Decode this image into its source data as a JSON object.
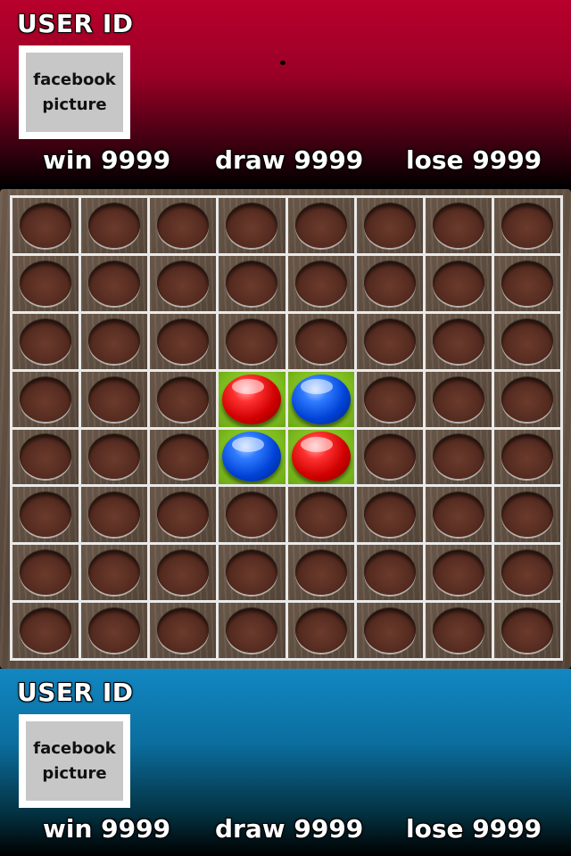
{
  "top_player": {
    "user_id": "USER ID",
    "picture_label": "facebook\npicture",
    "win": "win 9999",
    "draw": "draw 9999",
    "lose": "lose 9999"
  },
  "bottom_player": {
    "user_id": "USER ID",
    "picture_label": "facebook\npicture",
    "win": "win 9999",
    "draw": "draw 9999",
    "lose": "lose 9999"
  },
  "board": {
    "rows": 8,
    "cols": 8,
    "highlight_color": "#8cc63f",
    "top_color": "#b8002c",
    "bottom_color": "#1287c2",
    "pieces": [
      {
        "row": 3,
        "col": 3,
        "color": "red"
      },
      {
        "row": 3,
        "col": 4,
        "color": "blue"
      },
      {
        "row": 4,
        "col": 3,
        "color": "blue"
      },
      {
        "row": 4,
        "col": 4,
        "color": "red"
      }
    ]
  }
}
